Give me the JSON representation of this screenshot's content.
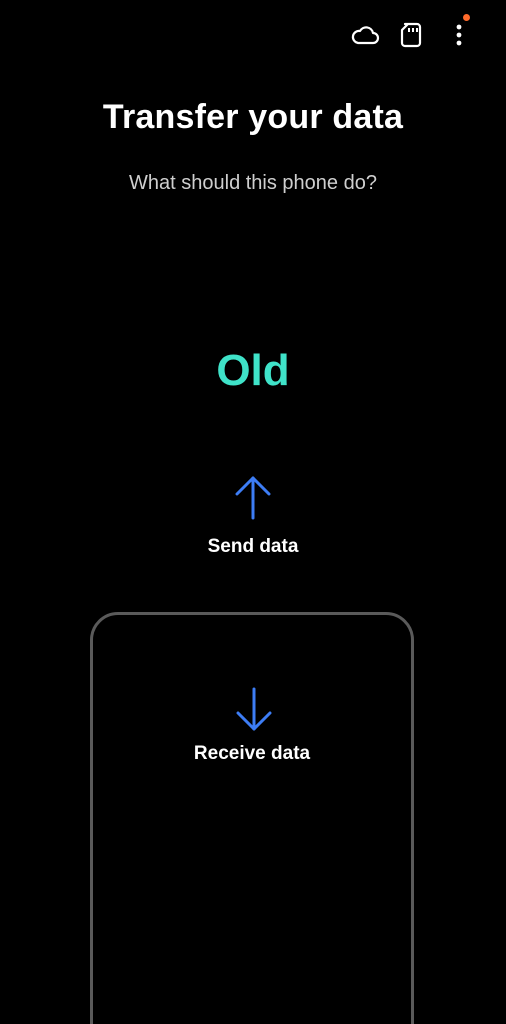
{
  "header": {
    "icons": {
      "cloud": "cloud-icon",
      "storage": "sd-card-icon",
      "menu": "more-options-icon"
    },
    "notification_dot_color": "#ff6a2b"
  },
  "main": {
    "title": "Transfer your data",
    "subtitle": "What should this phone do?",
    "phone_label": "Old",
    "send_label": "Send data",
    "receive_label": "Receive data",
    "accent_color": "#3fe3c9",
    "arrow_color": "#3d7df5"
  }
}
